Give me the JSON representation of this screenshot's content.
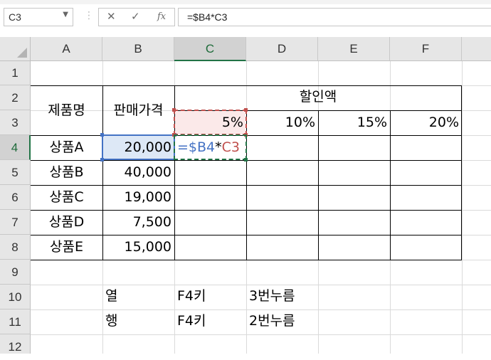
{
  "name_box": "C3",
  "formula_bar": {
    "cancel_icon": "✕",
    "enter_icon": "✓",
    "fx_label": "fx",
    "formula": "=$B4*C3"
  },
  "columns": [
    "A",
    "B",
    "C",
    "D",
    "E",
    "F"
  ],
  "rows": [
    "1",
    "2",
    "3",
    "4",
    "5",
    "6",
    "7",
    "8",
    "9",
    "10",
    "11",
    "12"
  ],
  "selected_column": "C",
  "selected_row": "4",
  "cells": {
    "a2": "제품명",
    "b2": "판매가격",
    "c2": "할인액",
    "c3": "5%",
    "d3": "10%",
    "e3": "15%",
    "f3": "20%",
    "a4": "상품A",
    "b4": "20,000",
    "a5": "상품B",
    "b5": "40,000",
    "a6": "상품C",
    "b6": "19,000",
    "a7": "상품D",
    "b7": "7,500",
    "a8": "상품E",
    "b8": "15,000",
    "b10": "열",
    "c10": "F4키",
    "d10": "3번누름",
    "b11": "행",
    "c11": "F4키",
    "d11": "2번누름"
  },
  "edit_formula": {
    "eq": "=",
    "ref1": "$B4",
    "op": "*",
    "ref2": "C3"
  },
  "colors": {
    "ref1": "#4472c4",
    "ref2": "#c0504d",
    "accent": "#217346"
  }
}
